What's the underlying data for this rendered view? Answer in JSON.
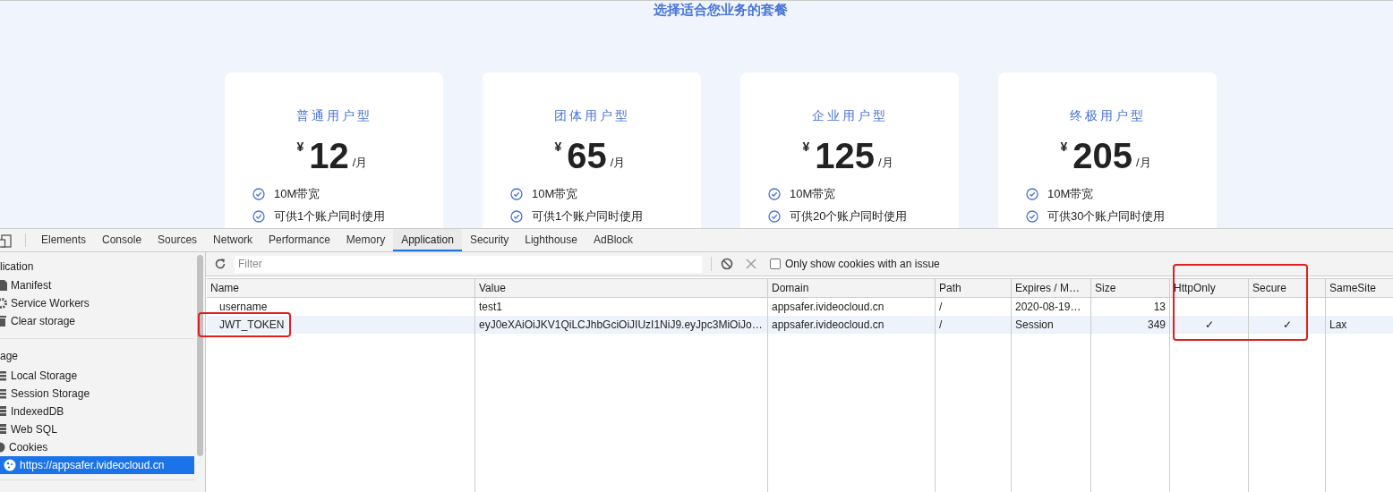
{
  "page": {
    "heading": "选择适合您业务的套餐",
    "plans": [
      {
        "name": "普通用户型",
        "currency": "¥",
        "price": "12",
        "unit": "/月",
        "features": [
          "10M带宽",
          "可供1个账户同时使用"
        ]
      },
      {
        "name": "团体用户型",
        "currency": "¥",
        "price": "65",
        "unit": "/月",
        "features": [
          "10M带宽",
          "可供1个账户同时使用"
        ]
      },
      {
        "name": "企业用户型",
        "currency": "¥",
        "price": "125",
        "unit": "/月",
        "features": [
          "10M带宽",
          "可供20个账户同时使用"
        ]
      },
      {
        "name": "终极用户型",
        "currency": "¥",
        "price": "205",
        "unit": "/月",
        "features": [
          "10M带宽",
          "可供30个账户同时使用"
        ]
      }
    ]
  },
  "devtools": {
    "tabs": [
      {
        "label": "Elements",
        "selected": false
      },
      {
        "label": "Console",
        "selected": false
      },
      {
        "label": "Sources",
        "selected": false
      },
      {
        "label": "Network",
        "selected": false
      },
      {
        "label": "Performance",
        "selected": false
      },
      {
        "label": "Memory",
        "selected": false
      },
      {
        "label": "Application",
        "selected": true
      },
      {
        "label": "Security",
        "selected": false
      },
      {
        "label": "Lighthouse",
        "selected": false
      },
      {
        "label": "AdBlock",
        "selected": false
      }
    ],
    "sidebar": [
      {
        "kind": "section",
        "label": "lication"
      },
      {
        "kind": "item",
        "label": "Manifest",
        "selected": false
      },
      {
        "kind": "item",
        "label": "Service Workers",
        "selected": false
      },
      {
        "kind": "item",
        "label": "Clear storage",
        "selected": false
      },
      {
        "kind": "section",
        "label": "age"
      },
      {
        "kind": "item",
        "label": "Local Storage",
        "selected": false
      },
      {
        "kind": "item",
        "label": "Session Storage",
        "selected": false
      },
      {
        "kind": "item",
        "label": "IndexedDB",
        "selected": false
      },
      {
        "kind": "item",
        "label": "Web SQL",
        "selected": false
      },
      {
        "kind": "item",
        "label": "Cookies",
        "selected": false
      },
      {
        "kind": "subitem",
        "label": "https://appsafer.ivideocloud.cn",
        "selected": true
      }
    ],
    "filter": {
      "placeholder": "Filter"
    },
    "issue_filter": {
      "label": "Only show cookies with an issue",
      "checked": false
    },
    "columns": [
      {
        "label": "Name",
        "boxed": false
      },
      {
        "label": "Value",
        "boxed": false
      },
      {
        "label": "Domain",
        "boxed": false
      },
      {
        "label": "Path",
        "boxed": false
      },
      {
        "label": "Expires / M…",
        "boxed": false
      },
      {
        "label": "Size",
        "boxed": false
      },
      {
        "label": "HttpOnly",
        "boxed": true
      },
      {
        "label": "Secure",
        "boxed": true
      },
      {
        "label": "SameSite",
        "boxed": false
      }
    ],
    "rows": [
      {
        "name_boxed": false,
        "selected": false,
        "cells": [
          "username",
          "test1",
          "appsafer.ivideocloud.cn",
          "/",
          "2020-08-19…",
          "13",
          "",
          "",
          ""
        ]
      },
      {
        "name_boxed": true,
        "selected": true,
        "cells": [
          "JWT_TOKEN",
          "eyJ0eXAiOiJKV1QiLCJhbGciOiJIUzI1NiJ9.eyJpc3MiOiJo…",
          "appsafer.ivideocloud.cn",
          "/",
          "Session",
          "349",
          "✓",
          "✓",
          "Lax"
        ]
      }
    ]
  }
}
